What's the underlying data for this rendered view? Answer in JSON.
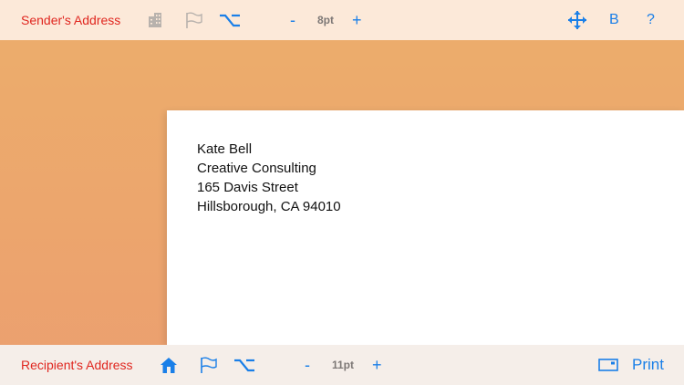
{
  "sender_toolbar": {
    "label": "Sender's Address",
    "font_size": "8pt",
    "decrease": "-",
    "increase": "+",
    "bold": "B",
    "help": "?",
    "icons": [
      "building-icon",
      "flag-icon",
      "option-key-icon",
      "move-icon"
    ]
  },
  "recipient_toolbar": {
    "label": "Recipient's Address",
    "font_size": "11pt",
    "decrease": "-",
    "increase": "+",
    "print": "Print",
    "icons": [
      "home-icon",
      "flag-icon",
      "option-key-icon",
      "envelope-icon"
    ]
  },
  "address": {
    "lines": [
      "Kate Bell",
      "Creative Consulting",
      "165 Davis Street",
      "Hillsborough, CA 94010"
    ]
  },
  "colors": {
    "label_red": "#e0261f",
    "accent_blue": "#1a7fe8",
    "disabled_gray": "#b8b2ad"
  }
}
